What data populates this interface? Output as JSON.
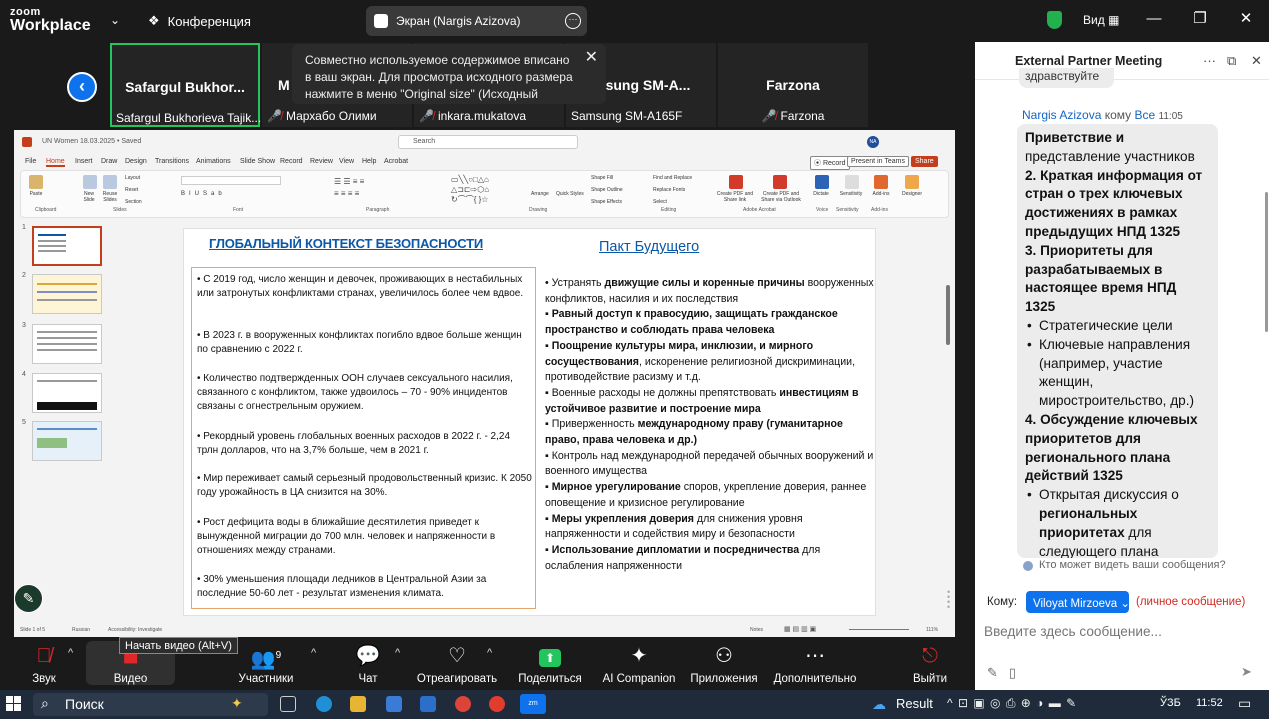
{
  "app": {
    "brand_top": "zoom",
    "brand_bottom": "Workplace",
    "conference_label": "Конференция",
    "view_label": "Вид"
  },
  "screen_share": {
    "label": "Экран (Nargis Azizova)"
  },
  "thumbnails": {
    "tiles": [
      {
        "name": "Safargul Bukhor...",
        "label": "Safargul Bukhorieva Tajik..."
      },
      {
        "name": "М",
        "label": "Мархабо Олими"
      },
      {
        "name": "",
        "label": "inkara.mukatova"
      },
      {
        "name": "Samsung SM-A...",
        "label": "Samsung SM-A165F"
      },
      {
        "name": "Farzona",
        "label": "Farzona"
      }
    ]
  },
  "tooltip": {
    "text": "Совместно используемое содержимое вписано в ваш экран. Для просмотра исходного размера нажмите в меню \"Original size\" (Исходный"
  },
  "ppt": {
    "filename": "UN Women 18.03.2025 • Saved",
    "search_placeholder": "Search",
    "avatar": "NA",
    "tabs": [
      "File",
      "Home",
      "Insert",
      "Draw",
      "Design",
      "Transitions",
      "Animations",
      "Slide Show",
      "Record",
      "Review",
      "View",
      "Help",
      "Acrobat"
    ],
    "record_btn": "Record",
    "present_btn": "Present in Teams",
    "share_btn": "Share",
    "ribbon_groups": [
      "Clipboard",
      "Slides",
      "Font",
      "Paragraph",
      "Drawing",
      "Editing",
      "Adobe Acrobat",
      "Voice",
      "Sensitivity",
      "Add-ins"
    ],
    "ribbon_buttons": [
      "Paste",
      "New Slide",
      "Reuse Slides",
      "Layout",
      "Reset",
      "Section",
      "Arrange",
      "Quick Styles",
      "Shape Fill",
      "Shape Outline",
      "Shape Effects",
      "Find and Replace",
      "Replace Fonts",
      "Select",
      "Create PDF and Share link",
      "Create PDF and Share via Outlook",
      "Dictate",
      "Sensitivity",
      "Add-ins",
      "Designer"
    ],
    "status_left": "Slide 1 of 5",
    "status_lang": "Russian",
    "status_access": "Accessibility: Investigate",
    "status_notes": "Notes",
    "zoom_pct": "111%",
    "slide_numbers": [
      "1",
      "2",
      "3",
      "4",
      "5"
    ]
  },
  "slide": {
    "left_title": "ГЛОБАЛЬНЫЙ КОНТЕКСТ БЕЗОПАСНОСТИ",
    "right_title": "Пакт Будущего",
    "left_bullets": [
      "• С 2019 год, число женщин и девочек, проживающих в нестабильных или затронутых конфликтами странах, увеличилось более чем вдвое.",
      "• В 2023 г. в вооруженных конфликтах погибло вдвое больше женщин по сравнению с 2022 г.",
      "• Количество подтвержденных ООН случаев сексуального насилия, связанного с конфликтом, также удвоилось – 70 - 90% инцидентов связаны с огнестрельным оружием.",
      "• Рекордный уровень глобальных военных расходов в 2022 г. - 2,24 трлн долларов, что  на 3,7% больше, чем в  2021 г.",
      "• Мир переживает самый серьезный продовольственный кризис. К 2050 году урожайность в ЦА снизится на 30%.",
      "• Рост дефицита воды в ближайшие десятилетия приведет к вынужденной миграции до 700 млн. человек и напряженности в отношениях между странами.",
      "• 30% уменьшения площади ледников в Центральной Азии за последние 50-60 лет - результат изменения климата."
    ],
    "right_items": [
      {
        "pre": "• Устранять ",
        "bold": "движущие силы и коренные причины",
        "post": " вооруженных конфликтов, насилия и их последствия"
      },
      {
        "pre": "▪   ",
        "bold": "Равный доступ к правосудию, защищать гражданское пространство и соблюдать права человека",
        "post": ""
      },
      {
        "pre": "▪   ",
        "bold": "Поощрение культуры мира, инклюзии, и мирного сосуществования",
        "post": ", искоренение религиозной дискриминации, противодействие расизму и т.д."
      },
      {
        "pre": "▪   Военные расходы не должны препятствовать ",
        "bold": "инвестициям в устойчивое развитие и построение мира",
        "post": ""
      },
      {
        "pre": "▪   Приверженность ",
        "bold": "международному праву (гуманитарное право, права человека и др.)",
        "post": ""
      },
      {
        "pre": "▪   Контроль над международной передачей обычных вооружений и военного имущества",
        "bold": "",
        "post": ""
      },
      {
        "pre": "▪   ",
        "bold": "Мирное урегулирование",
        "post": " споров, укрепление доверия, раннее оповещение и кризисное регулирование"
      },
      {
        "pre": "▪   ",
        "bold": "Меры укрепления доверия",
        "post": " для снижения уровня напряженности и содействия миру и безопасности"
      },
      {
        "pre": "▪   ",
        "bold": "Использование дипломатии и посредничества",
        "post": " для ослабления напряженности"
      }
    ]
  },
  "chat": {
    "title": "External Partner Meeting",
    "previous_message_fragment": "здравствуйте",
    "sender": "Nargis Azizova",
    "to_word": "кому",
    "to_target": "Все",
    "time": "11:05",
    "message_lines": [
      {
        "text": "Приветствие и",
        "bold": true,
        "bullet": false
      },
      {
        "text": "представление участников",
        "bold": false,
        "bullet": false
      },
      {
        "text": "2. Краткая информация от стран о трех ключевых достижениях в рамках предыдущих НПД 1325",
        "bold": true,
        "bullet": false
      },
      {
        "text": "3. Приоритеты для разрабатываемых в настоящее время НПД 1325",
        "bold": true,
        "bullet": false
      },
      {
        "text": "Стратегические цели",
        "bold": false,
        "bullet": true
      },
      {
        "text": "Ключевые направления (например, участие женщин, миростроительство, др.)",
        "bold": false,
        "bullet": true
      },
      {
        "text": "4. Обсуждение ключевых приоритетов для регионального плана действий 1325",
        "bold": true,
        "bullet": false
      },
      {
        "text": "Открытая дискуссия о ",
        "bold": false,
        "bullet": true,
        "bold_tail": "региональных приоритетах",
        "tail": " для следующего плана"
      }
    ],
    "who_can_see": "Кто может видеть ваши сообщения?",
    "to_label": "Кому:",
    "recipient": "Viloyat Mirzoeva",
    "private_note": "(личное сообщение)",
    "input_placeholder": "Введите здесь сообщение..."
  },
  "toolbar": {
    "audio": "Звук",
    "video": "Видео",
    "video_tooltip": "Начать видео (Alt+V)",
    "participants": "Участники",
    "participants_count": "9",
    "chat": "Чат",
    "react": "Отреагировать",
    "share": "Поделиться",
    "ai": "AI Companion",
    "apps": "Приложения",
    "more": "Дополнительно",
    "leave": "Выйти"
  },
  "taskbar": {
    "search": "Поиск",
    "result": "Result",
    "lang": "ЎЗБ",
    "time": "11:52"
  },
  "colors": {
    "accent": "#0e72ed",
    "active_speaker": "#23c55e",
    "ppt_brand": "#c43e1c",
    "slide_heading": "#0b57a8",
    "leave": "#e02828"
  }
}
